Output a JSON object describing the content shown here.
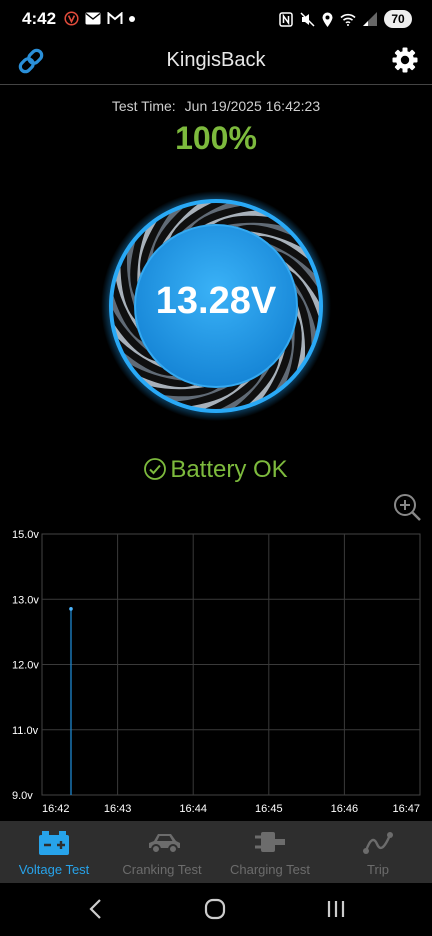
{
  "status_bar": {
    "time": "4:42",
    "battery_level": "70"
  },
  "header": {
    "title": "KingisBack"
  },
  "test": {
    "time_label": "Test Time:",
    "time_value": "Jun 19/2025 16:42:23",
    "percent": "100%",
    "voltage": "13.28V",
    "status": "Battery OK"
  },
  "chart_data": {
    "type": "line",
    "x_categories": [
      "16:42",
      "16:43",
      "16:44",
      "16:45",
      "16:46",
      "16:47"
    ],
    "ytick_labels": [
      "15.0v",
      "13.0v",
      "12.0v",
      "11.0v",
      "9.0v"
    ],
    "ylim": [
      9.0,
      15.0
    ],
    "grid": true,
    "series": [
      {
        "points": [
          {
            "x": "16:42:23",
            "y": 13.28
          }
        ]
      }
    ]
  },
  "tabs": [
    {
      "label": "Voltage Test",
      "icon": "battery-icon",
      "active": true
    },
    {
      "label": "Cranking Test",
      "icon": "car-icon",
      "active": false
    },
    {
      "label": "Charging Test",
      "icon": "plug-icon",
      "active": false
    },
    {
      "label": "Trip",
      "icon": "trip-icon",
      "active": false
    }
  ],
  "colors": {
    "accent": "#27a3ea",
    "ok": "#7dba3d",
    "gauge": "#2fa8ef"
  }
}
